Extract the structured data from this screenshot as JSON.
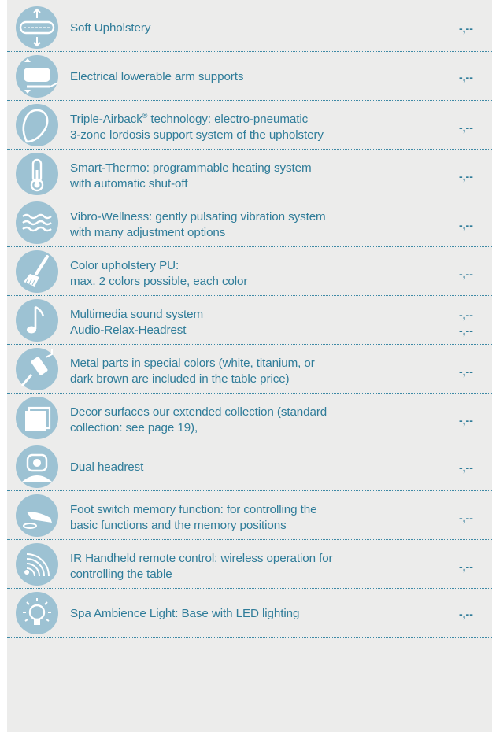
{
  "items": [
    {
      "icon": "upholstery-icon",
      "lines": [
        "Soft Upholstery"
      ],
      "prices": [
        "-,--"
      ]
    },
    {
      "icon": "arm-support-icon",
      "lines": [
        "Electrical lowerable arm supports"
      ],
      "prices": [
        "-,--"
      ]
    },
    {
      "icon": "airback-icon",
      "lines": [
        "Triple-Airback® technology: electro-pneumatic",
        "3-zone lordosis support system of the upholstery"
      ],
      "prices": [
        "-,--"
      ]
    },
    {
      "icon": "thermometer-icon",
      "lines": [
        "Smart-Thermo: programmable heating system",
        "with automatic shut-off"
      ],
      "prices": [
        "-,--"
      ]
    },
    {
      "icon": "vibration-waves-icon",
      "lines": [
        "Vibro-Wellness: gently pulsating vibration system",
        "with many adjustment options"
      ],
      "prices": [
        "-,--"
      ]
    },
    {
      "icon": "paint-brush-icon",
      "lines": [
        "Color upholstery PU:",
        "max. 2 colors possible, each color"
      ],
      "prices": [
        "-,--"
      ]
    },
    {
      "icon": "music-note-icon",
      "lines": [
        "Multimedia sound system",
        "Audio-Relax-Headrest"
      ],
      "prices": [
        "-,--",
        "-,--"
      ]
    },
    {
      "icon": "paint-roller-icon",
      "lines": [
        "Metal parts in special colors (white, titanium, or",
        "dark brown are included in the table price)"
      ],
      "prices": [
        "-,--"
      ]
    },
    {
      "icon": "decor-surface-icon",
      "lines": [
        "Decor surfaces  our extended collection (standard",
        "collection: see page 19),"
      ],
      "prices": [
        "-,--"
      ]
    },
    {
      "icon": "headrest-icon",
      "lines": [
        "Dual headrest"
      ],
      "prices": [
        "-,--"
      ]
    },
    {
      "icon": "foot-switch-icon",
      "lines": [
        "Foot switch memory function: for controlling the",
        "basic functions and the memory positions"
      ],
      "prices": [
        "-,--"
      ]
    },
    {
      "icon": "remote-control-icon",
      "lines": [
        "IR Handheld remote control: wireless operation for",
        "controlling the table"
      ],
      "prices": [
        "-,--"
      ]
    },
    {
      "icon": "light-bulb-icon",
      "lines": [
        "Spa Ambience Light: Base with LED lighting"
      ],
      "prices": [
        "-,--"
      ]
    }
  ],
  "colors": {
    "panel": "#ececeb",
    "text": "#2f7c99",
    "icon_circle": "#9dc2d3",
    "divider": "#3d89a5"
  }
}
